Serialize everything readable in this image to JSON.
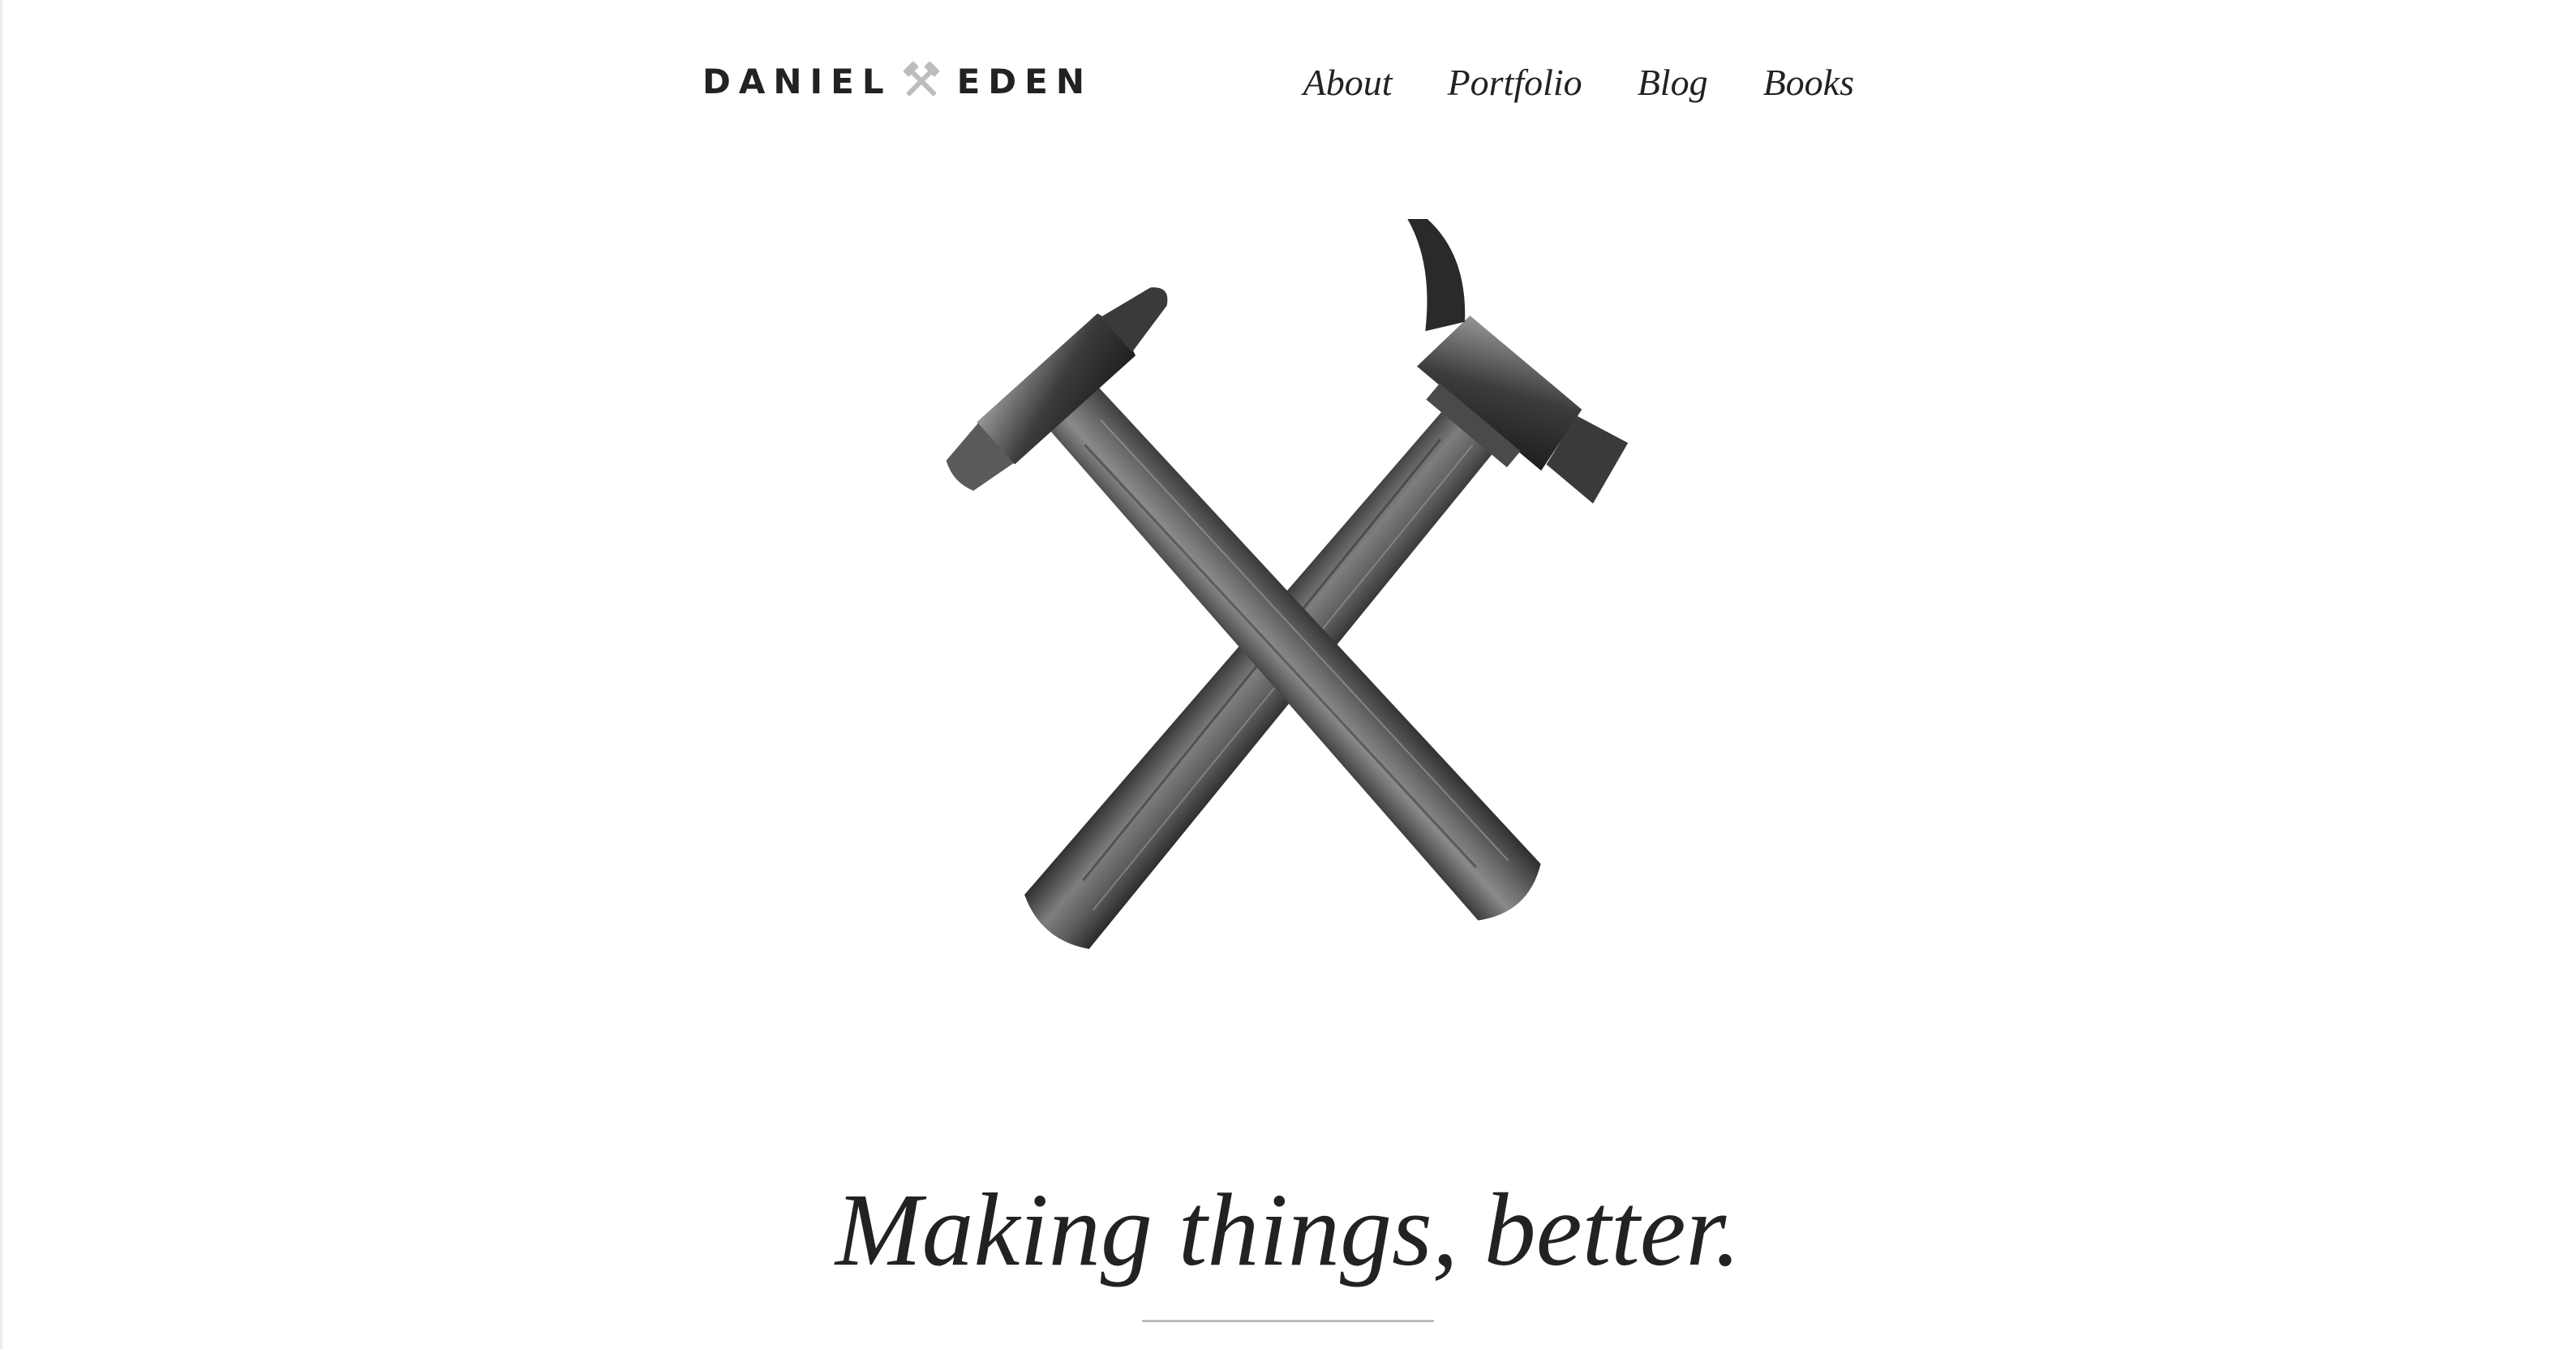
{
  "header": {
    "logo": {
      "first": "DANIEL",
      "last": "EDEN",
      "icon": "crossed-hammers-icon"
    },
    "nav": [
      {
        "label": "About"
      },
      {
        "label": "Portfolio"
      },
      {
        "label": "Blog"
      },
      {
        "label": "Books"
      }
    ]
  },
  "hero": {
    "image": "crossed-hammers-photo"
  },
  "tagline": "Making things, better.",
  "colors": {
    "text": "#222222",
    "logo_icon": "#bdbdbd",
    "rule": "#bdbdbd",
    "background": "#ffffff"
  }
}
